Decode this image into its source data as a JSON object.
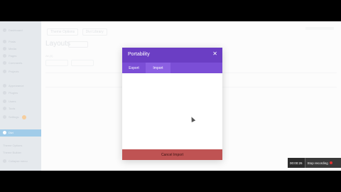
{
  "sidebar": {
    "items": [
      {
        "label": "Dashboard"
      },
      {
        "label": "Posts"
      },
      {
        "label": "Media"
      },
      {
        "label": "Pages"
      },
      {
        "label": "Comments"
      },
      {
        "label": "Projects"
      },
      {
        "label": "Appearance"
      },
      {
        "label": "Plugins"
      },
      {
        "label": "Users"
      },
      {
        "label": "Tools"
      },
      {
        "label": "Settings"
      },
      {
        "label": "Divi"
      }
    ],
    "active_label": "Divi",
    "footer_items": [
      {
        "label": "Theme Options"
      },
      {
        "label": "Theme Builder"
      },
      {
        "label": "Collapse menu"
      }
    ]
  },
  "content": {
    "breadcrumbs": [
      "Theme Options",
      "Divi Library"
    ],
    "page_title": "Layouts",
    "filter_label": "All (0)"
  },
  "modal": {
    "title": "Portability",
    "close_icon": "close-icon",
    "tabs": [
      {
        "label": "Export"
      },
      {
        "label": "Import"
      }
    ],
    "active_tab": "Import",
    "footer_label": "Cancel Import",
    "colors": {
      "header": "#6b3ec4",
      "tabs": "#7b4ed6",
      "footer": "#bf5353"
    }
  },
  "recorder": {
    "time": "00:00:26",
    "stop_label": "Stop recording"
  }
}
